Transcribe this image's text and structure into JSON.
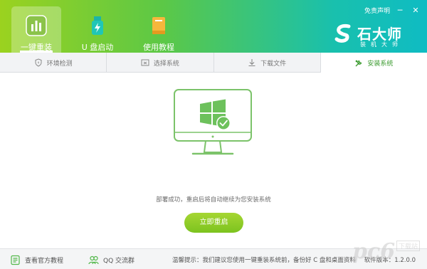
{
  "nav": {
    "tabs": [
      {
        "label": "一键重装",
        "icon": "chart-bars-icon",
        "active": true
      },
      {
        "label": "U 盘启动",
        "icon": "usb-flash-icon",
        "active": false
      },
      {
        "label": "使用教程",
        "icon": "book-icon",
        "active": false
      }
    ]
  },
  "top": {
    "disclaimer": "免责声明",
    "minimize": "─",
    "close": "✕"
  },
  "brand": {
    "name": "石大师",
    "subtitle": "装机大师"
  },
  "steps": [
    {
      "label": "环境检测",
      "icon": "shield-icon",
      "active": false
    },
    {
      "label": "选择系统",
      "icon": "window-icon",
      "active": false
    },
    {
      "label": "下载文件",
      "icon": "download-icon",
      "active": false
    },
    {
      "label": "安装系统",
      "icon": "wrench-icon",
      "active": true
    }
  ],
  "main": {
    "message": "部署成功，重启后将自动继续为您安装系统",
    "restart_button": "立即重启"
  },
  "footer": {
    "tutorial_link": "查看官方教程",
    "qq_group_link": "QQ 交流群",
    "tip": "温馨提示：我们建议您使用一键重装系统前，备份好 C 盘和桌面资料",
    "version": "软件版本：1.2.0.0"
  },
  "watermark": {
    "text": "pc6",
    "sub": "下载站"
  },
  "colors": {
    "accent": "#7cc31f",
    "header_start": "#9bd21f",
    "header_end": "#0fbcc3",
    "active_step": "#3a9a2e"
  }
}
